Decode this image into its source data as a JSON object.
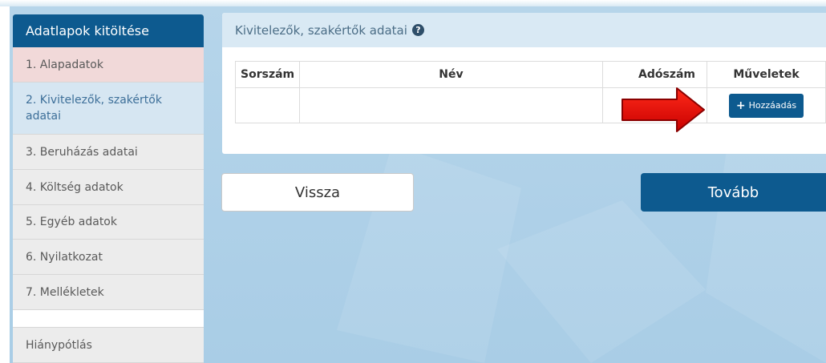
{
  "sidebar": {
    "title": "Adatlapok kitöltése",
    "items": [
      {
        "label": "1. Alapadatok",
        "state": "red"
      },
      {
        "label": "2. Kivitelezők, szakértők adatai",
        "state": "current"
      },
      {
        "label": "3. Beruházás adatai",
        "state": "normal"
      },
      {
        "label": "4. Költség adatok",
        "state": "normal"
      },
      {
        "label": "5. Egyéb adatok",
        "state": "normal"
      },
      {
        "label": "6. Nyilatkozat",
        "state": "normal"
      },
      {
        "label": "7. Mellékletek",
        "state": "normal"
      }
    ],
    "extra_item": "Hiánypótlás"
  },
  "panel": {
    "title": "Kivitelezők, szakértők adatai",
    "help_icon": "question-circle-icon",
    "table": {
      "headers": [
        "Sorszám",
        "Név",
        "Adószám",
        "Műveletek"
      ],
      "add_label": "Hozzáadás",
      "add_icon": "plus-icon"
    }
  },
  "navigation": {
    "back_label": "Vissza",
    "next_label": "Tovább"
  },
  "colors": {
    "primary": "#0d5a8f",
    "panel_header": "#d9e9f4",
    "active_red": "#f1d9d9",
    "active_blue": "#d6e6f2",
    "annotation_arrow": "#e00000"
  }
}
